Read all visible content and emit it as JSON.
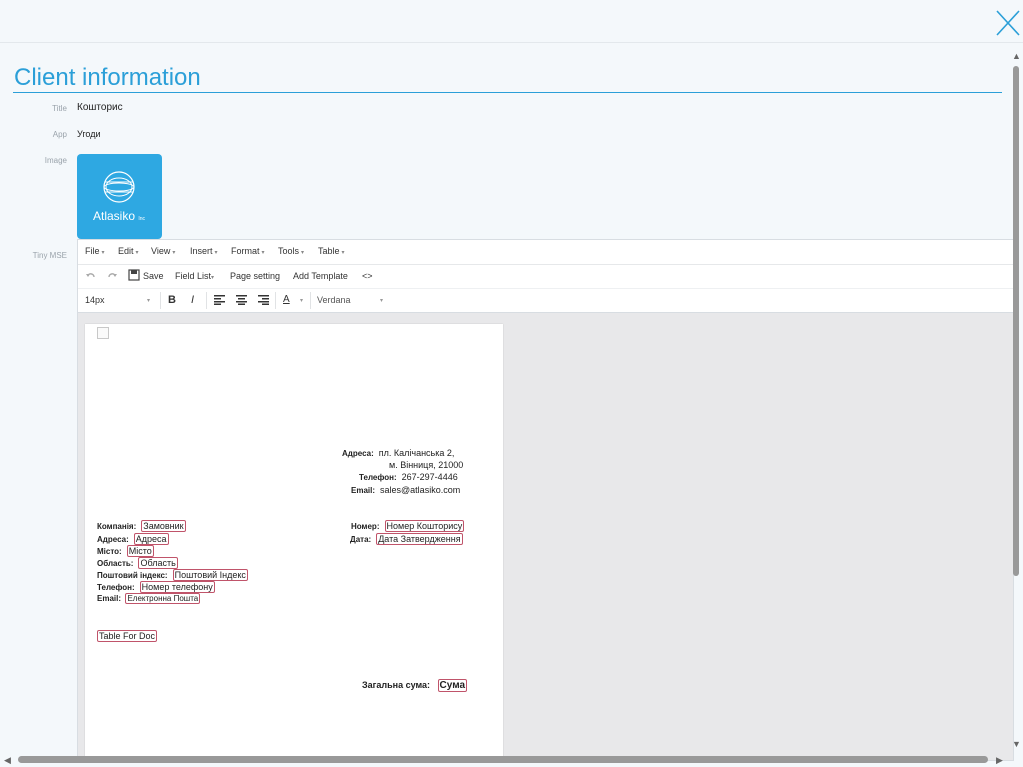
{
  "header": {
    "title": "Client information"
  },
  "fields": {
    "title_label": "Title",
    "title_value": "Кошторис",
    "app_label": "App",
    "app_value": "Угоди",
    "image_label": "Image",
    "tiny_label": "Tiny MSE"
  },
  "logo": {
    "brand": "Atlasiko",
    "suffix": "Inc"
  },
  "editor": {
    "menu": [
      "File",
      "Edit",
      "View",
      "Insert",
      "Format",
      "Tools",
      "Table"
    ],
    "toolbar1": {
      "save": "Save",
      "field_list": "Field List",
      "page_setting": "Page setting",
      "add_template": "Add Template",
      "code": "<>"
    },
    "toolbar2": {
      "font_size": "14px",
      "font_family": "Verdana",
      "bold": "B",
      "italic": "I",
      "text_color": "A"
    }
  },
  "document": {
    "address_label": "Адреса:",
    "address_line1": "пл. Калічанська 2,",
    "address_line2": "м. Вінниця, 21000",
    "phone_label": "Телефон:",
    "phone_value": "267-297-4446",
    "email_label": "Email:",
    "email_value": "sales@atlasiko.com",
    "client": [
      {
        "label": "Компанія:",
        "field": "Замовник"
      },
      {
        "label": "Адреса:",
        "field": "Адреса"
      },
      {
        "label": "Місто:",
        "field": "Місто"
      },
      {
        "label": "Область:",
        "field": "Область"
      },
      {
        "label": "Поштовий індекс:",
        "field": "Поштовий Індекс"
      },
      {
        "label": "Телефон:",
        "field": "Номер телефону"
      },
      {
        "label": "Email:",
        "field": "Електронна Пошта"
      }
    ],
    "number_label": "Номер:",
    "number_field": "Номер Кошторису",
    "date_label": "Дата:",
    "date_field": "Дата Затвердження",
    "table_field": "Table For Doc",
    "total_label": "Загальна сума:",
    "total_field": "Сума"
  },
  "colors": {
    "accent": "#2b9fd8",
    "logo_bg": "#2ea8e2",
    "field_border": "#c0546a"
  }
}
